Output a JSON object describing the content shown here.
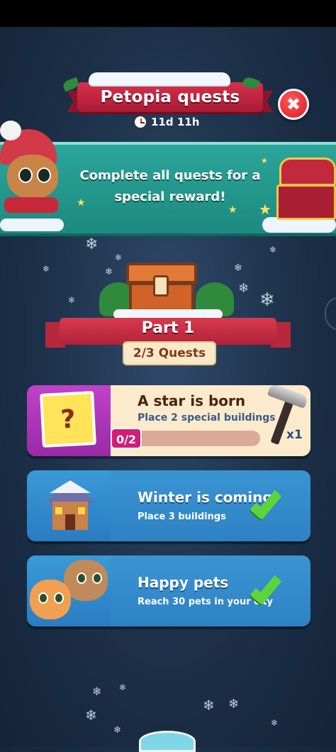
{
  "header": {
    "title": "Petopia quests",
    "timer": "11d 11h",
    "close_symbol": "✖"
  },
  "banner": {
    "text": "Complete all quests for a special reward!"
  },
  "part": {
    "label": "Part 1",
    "quests_progress": "2/3 Quests"
  },
  "quests": [
    {
      "title": "A star is born",
      "description": "Place 2 special buildings",
      "progress": "0/2",
      "reward_count": "x1",
      "thumb_symbol": "?",
      "reward_icon": "hammer-icon",
      "completed": false
    },
    {
      "title": "Winter is coming",
      "description": "Place 3 buildings",
      "completed": true
    },
    {
      "title": "Happy pets",
      "description": "Reach 30 pets in your city",
      "completed": true
    }
  ],
  "colors": {
    "ribbon_red": "#c8263e",
    "banner_teal": "#23998e",
    "card_blue": "#3490cf",
    "card_cream": "#fbebcc",
    "progress_magenta": "#d31c78",
    "check_green": "#5fd43a"
  }
}
